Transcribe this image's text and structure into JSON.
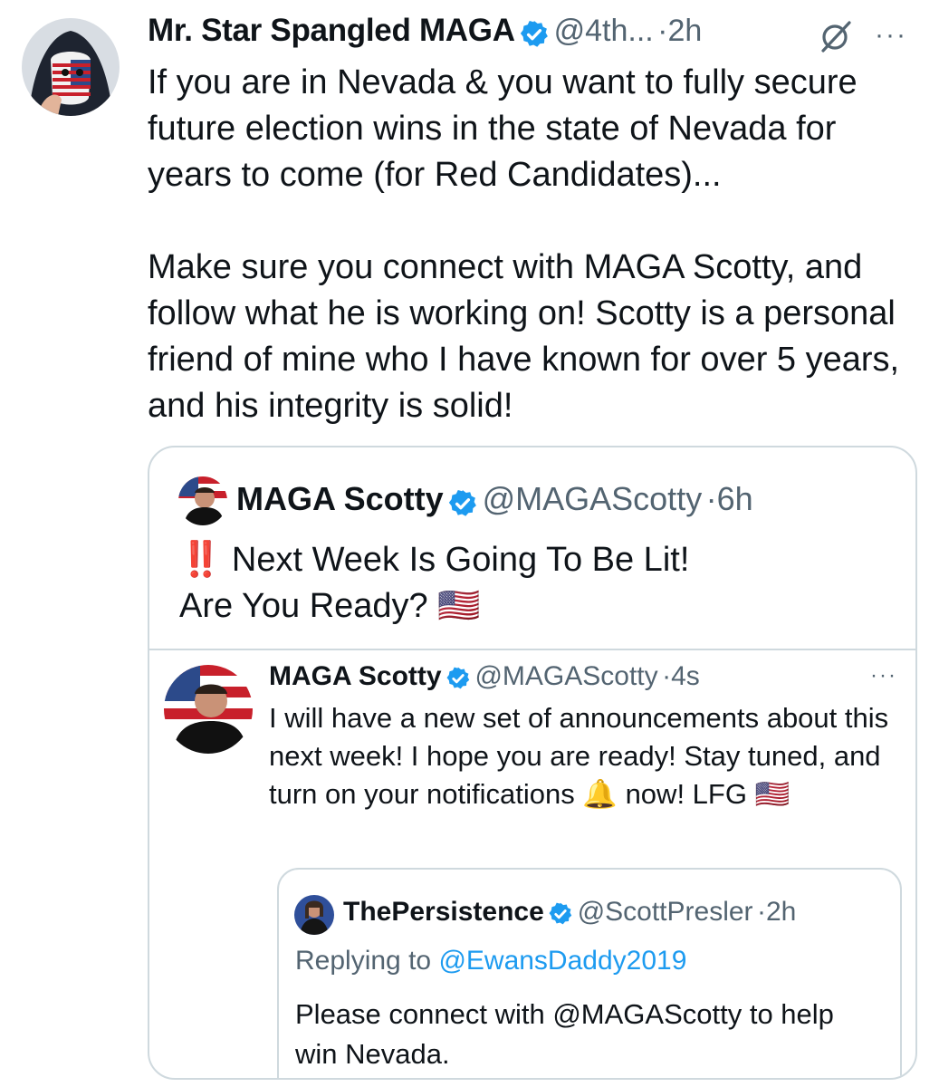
{
  "main_tweet": {
    "author_name": "Mr. Star Spangled MAGA",
    "handle": "@4th...",
    "time": "·2h",
    "body": "If you are in Nevada & you want to fully secure future election wins in the state of Nevada for years to come (for Red Candidates)...\n\nMake sure you connect with MAGA Scotty, and follow what he is working on! Scotty is a personal friend of mine who I have known for over 5 years, and his integrity is solid!",
    "more_label": "···"
  },
  "quoted_tweet": {
    "author_name": "MAGA Scotty",
    "handle": "@MAGAScotty",
    "time": "·6h",
    "body": "‼️ Next Week Is Going To Be Lit!\nAre You Ready? 🇺🇸"
  },
  "reply_tweet": {
    "author_name": "MAGA Scotty",
    "handle": "@MAGAScotty",
    "time": "·4s",
    "body": "I will have a new set of announcements about this next week! I hope you are ready! Stay tuned, and turn on your notifications 🔔 now! LFG 🇺🇸",
    "more_label": "···"
  },
  "nested_quote": {
    "author_name": "ThePersistence",
    "handle": "@ScottPresler",
    "time": "·2h",
    "replying_prefix": "Replying to ",
    "replying_to": "@EwansDaddy2019",
    "body": "Please connect with @MAGAScotty to help win Nevada."
  },
  "colors": {
    "accent": "#1d9bf0",
    "muted": "#536471",
    "border": "#cfd9de"
  },
  "icons": [
    "verified-badge-icon",
    "grok-icon",
    "more-icon",
    "avatar"
  ]
}
